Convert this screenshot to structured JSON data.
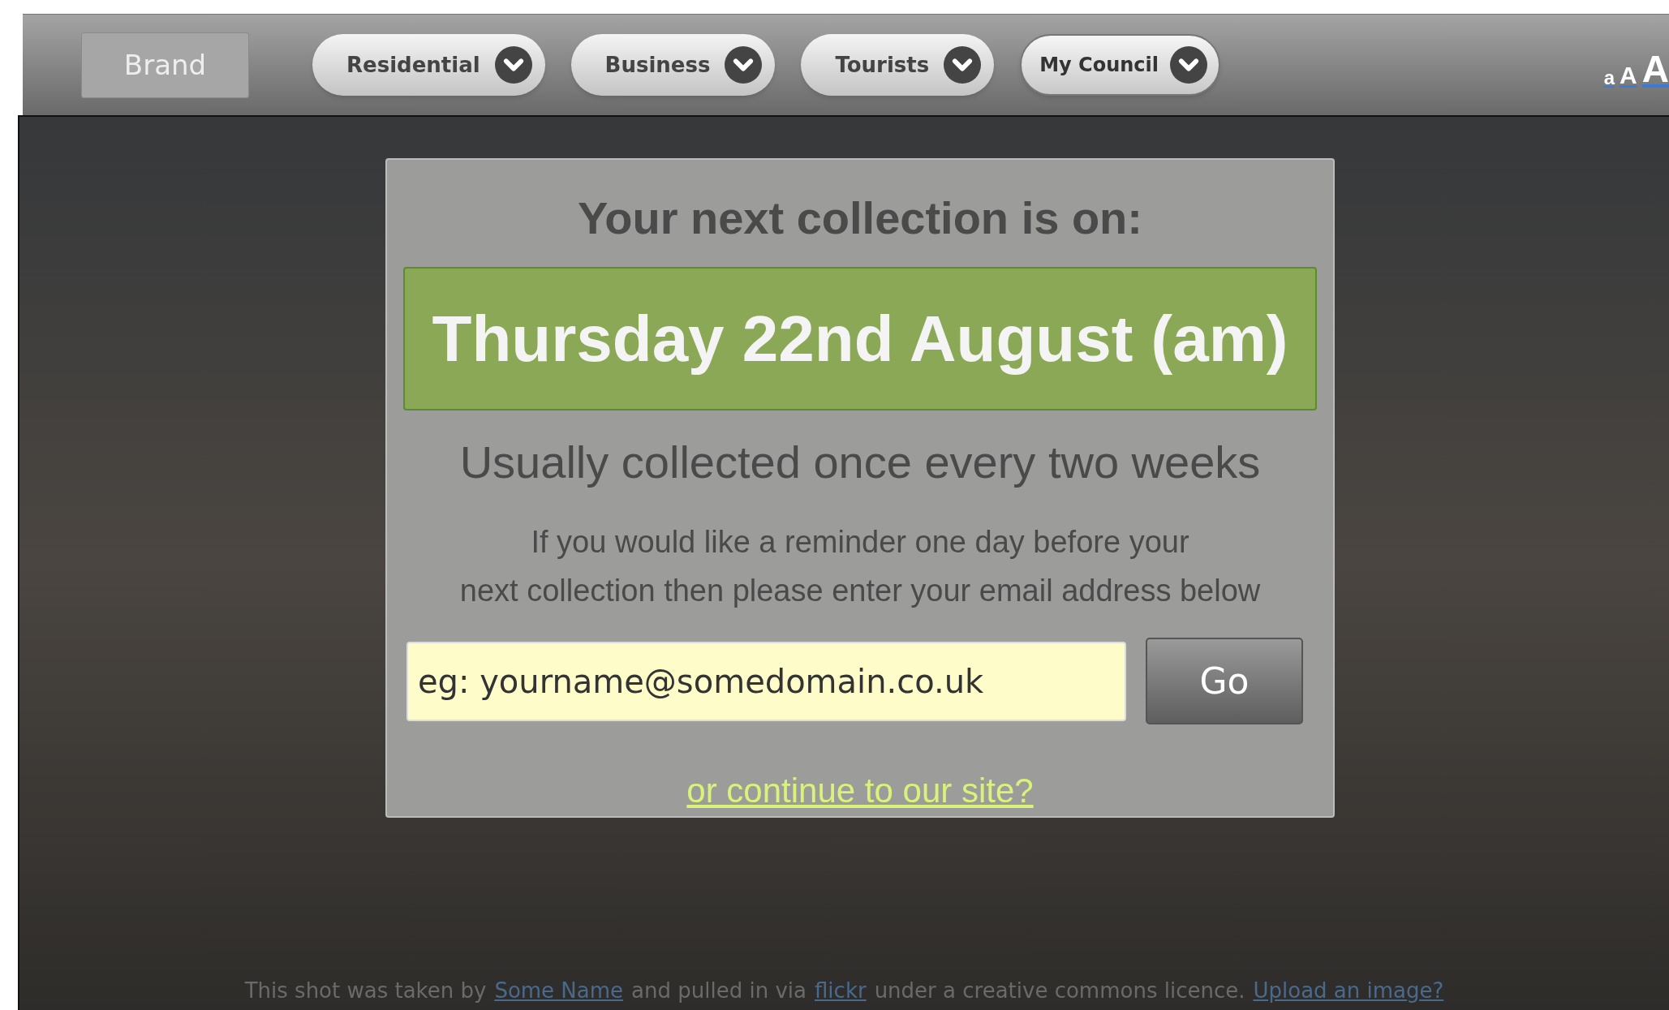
{
  "nav": {
    "brand": "Brand",
    "menus": [
      {
        "label": "Residential",
        "selected": false
      },
      {
        "label": "Business",
        "selected": false
      },
      {
        "label": "Tourists",
        "selected": false
      },
      {
        "label": "My Council",
        "selected": true
      }
    ],
    "text_sizes": [
      "a",
      "A",
      "A"
    ]
  },
  "modal": {
    "heading": "Your next collection is on:",
    "date": "Thursday 22nd August (am)",
    "frequency": "Usually collected once every two weeks",
    "reminder_text": [
      "If you would like a reminder one day before your",
      "next collection then please enter your email address below"
    ],
    "email": {
      "placeholder": "eg: yourname@somedomain.co.uk"
    },
    "go_button": "Go",
    "continue_link": "or continue to our site?"
  },
  "credit": [
    {
      "kind": "text",
      "text": "This shot was taken by"
    },
    {
      "kind": "link",
      "text": "Some Name"
    },
    {
      "kind": "text",
      "text": "and pulled in via"
    },
    {
      "kind": "link",
      "text": "flickr"
    },
    {
      "kind": "text",
      "text": "under a creative commons licence."
    },
    {
      "kind": "link",
      "text": "Upload an image?"
    }
  ]
}
